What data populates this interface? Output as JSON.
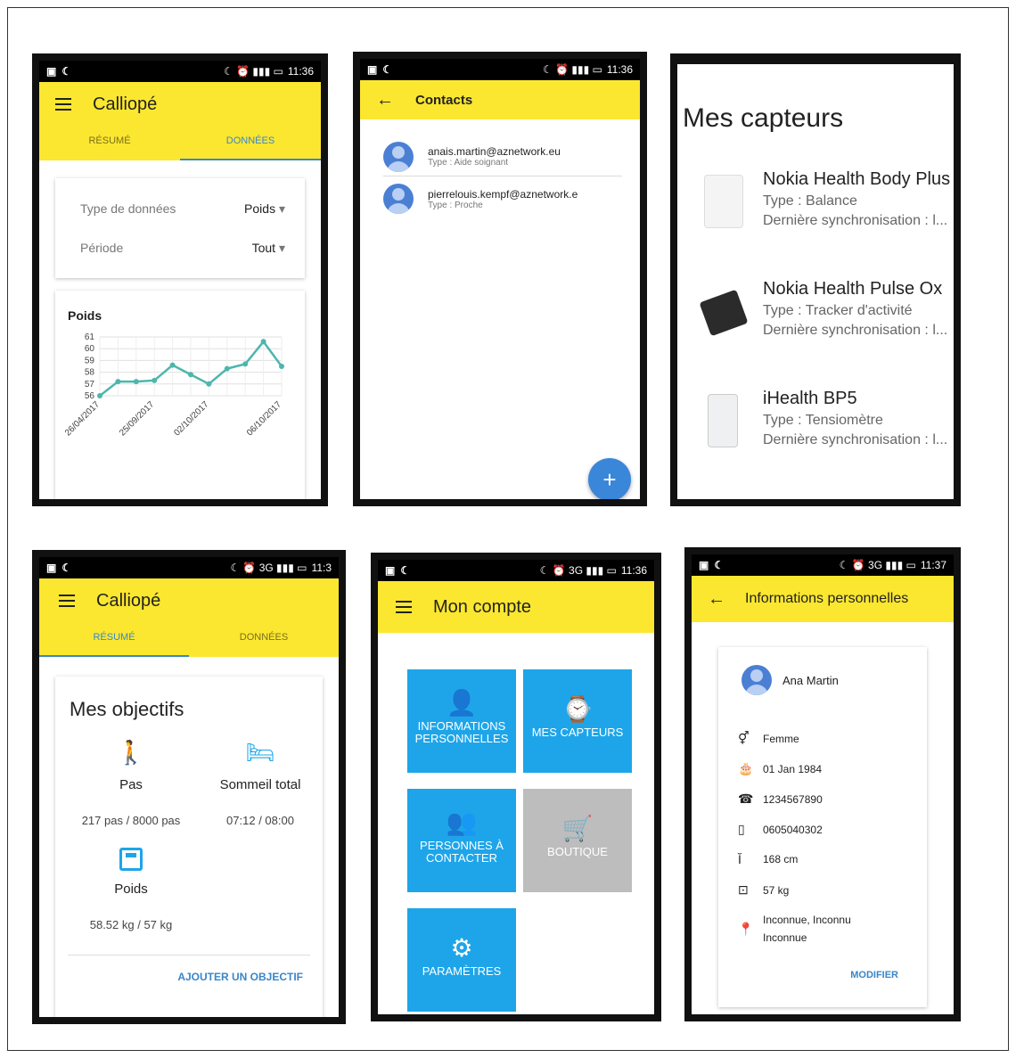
{
  "status": {
    "p1_time": "11:36",
    "p2_time": "11:36",
    "p4_time": "11:3",
    "p5_time": "11:36",
    "p6_time": "11:37"
  },
  "p1": {
    "title": "Calliopé",
    "tab_resume": "RÉSUMÉ",
    "tab_donnees": "DONNÉES",
    "filter_type_label": "Type de données",
    "filter_type_value": "Poids",
    "filter_period_label": "Période",
    "filter_period_value": "Tout",
    "chart_title": "Poids"
  },
  "chart_data": {
    "type": "line",
    "title": "Poids",
    "x": [
      "26/04/2017",
      "",
      "",
      "25/09/2017",
      "",
      "",
      "02/10/2017",
      "",
      "",
      "",
      "06/10/2017",
      ""
    ],
    "x_tick_labels": [
      "26/04/2017",
      "25/09/2017",
      "02/10/2017",
      "06/10/2017"
    ],
    "values": [
      56,
      57.2,
      57.2,
      57.3,
      58.6,
      57.8,
      57,
      58.3,
      58.7,
      60.6,
      58.5
    ],
    "y_ticks": [
      56,
      57,
      58,
      59,
      60,
      61
    ],
    "ylim": [
      56,
      61
    ],
    "grid": true,
    "color": "#4db6ac"
  },
  "p2": {
    "title": "Contacts",
    "contacts": [
      {
        "email": "anais.martin@aznetwork.eu",
        "type": "Type : Aide soignant"
      },
      {
        "email": "pierrelouis.kempf@aznetwork.e",
        "type": "Type : Proche"
      }
    ],
    "fab": "+"
  },
  "p3": {
    "title": "Mes capteurs",
    "sensors": [
      {
        "name": "Nokia Health Body Plus",
        "type": "Type : Balance",
        "sync": "Dernière synchronisation : l..."
      },
      {
        "name": "Nokia Health Pulse Ox",
        "type": "Type : Tracker d'activité",
        "sync": "Dernière synchronisation : l..."
      },
      {
        "name": "iHealth BP5",
        "type": "Type : Tensiomètre",
        "sync": "Dernière synchronisation : l..."
      }
    ]
  },
  "p4": {
    "title": "Calliopé",
    "tab_resume": "RÉSUMÉ",
    "tab_donnees": "DONNÉES",
    "card_title": "Mes objectifs",
    "goal_pas_label": "Pas",
    "goal_pas_value": "217 pas / 8000 pas",
    "goal_sleep_label": "Sommeil total",
    "goal_sleep_value": "07:12 / 08:00",
    "goal_weight_label": "Poids",
    "goal_weight_value": "58.52 kg / 57 kg",
    "add_goal": "AJOUTER UN OBJECTIF"
  },
  "p5": {
    "title": "Mon compte",
    "tile_info_1": "INFORMATIONS",
    "tile_info_2": "PERSONNELLES",
    "tile_capteurs": "MES CAPTEURS",
    "tile_persons_1": "PERSONNES À",
    "tile_persons_2": "CONTACTER",
    "tile_boutique": "BOUTIQUE",
    "tile_params": "PARAMÈTRES"
  },
  "p6": {
    "title": "Informations personnelles",
    "name": "Ana Martin",
    "gender": "Femme",
    "birthdate": "01 Jan 1984",
    "phone": "1234567890",
    "mobile": "0605040302",
    "height": "168 cm",
    "weight": "57 kg",
    "address_1": "Inconnue, Inconnu",
    "address_2": "Inconnue",
    "modify": "MODIFIER"
  }
}
